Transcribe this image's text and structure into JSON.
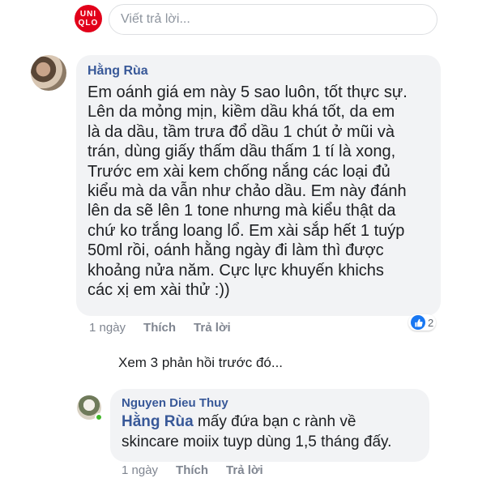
{
  "composer": {
    "logo_top": "UNI",
    "logo_bottom": "QLO",
    "placeholder": "Viết trả lời..."
  },
  "comment1": {
    "author": "Hằng Rùa",
    "lines": [
      "Em oánh giá em này 5 sao luôn, tốt thực sự.",
      "Lên da mỏng mịn, kiềm dầu khá tốt, da em",
      "là da dầu, tầm trưa đổ dầu 1 chút ở mũi và",
      "trán, dùng giấy thấm dầu thấm 1 tí là xong,",
      "Trước em xài kem chống nắng các loại đủ",
      "kiểu mà da vẫn như chảo dầu. Em này đánh",
      "lên da sẽ lên 1 tone nhưng mà kiểu thật da",
      "chứ ko trắng loang lổ. Em xài sắp hết 1 tuýp",
      "50ml rồi, oánh hằng ngày đi làm thì được",
      "khoảng nửa năm. Cực lực khuyến khichs",
      "các xị em xài thử :))"
    ],
    "time": "1 ngày",
    "like_label": "Thích",
    "reply_label": "Trả lời",
    "reaction_count": "2"
  },
  "view_more": "Xem 3 phản hồi trước đó...",
  "comment2": {
    "author": "Nguyen Dieu Thuy",
    "mention": "Hằng Rùa",
    "line1_rest": " mấy đứa bạn c rành về",
    "line2": "skincare moiix tuyp dùng 1,5 tháng đấy.",
    "time": "1 ngày",
    "like_label": "Thích",
    "reply_label": "Trả lời"
  },
  "colors": {
    "author_link": "#385898",
    "bubble": "#f2f3f5",
    "like_blue": "#1877f2",
    "uniqlo_red": "#e2001a"
  },
  "icons": [
    "uniqlo-logo",
    "like-icon",
    "online-status-icon"
  ]
}
